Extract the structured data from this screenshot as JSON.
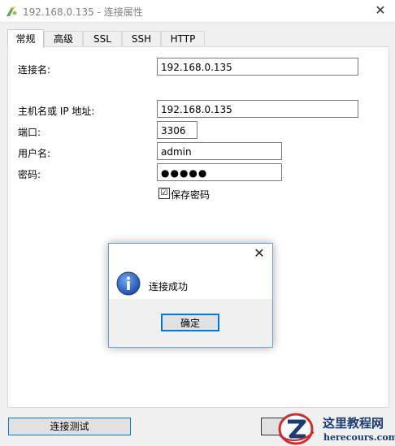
{
  "window": {
    "title": "192.168.0.135 - 连接属性",
    "close_glyph": "✕"
  },
  "tabs": [
    {
      "label": "常规",
      "active": true
    },
    {
      "label": "高级"
    },
    {
      "label": "SSL"
    },
    {
      "label": "SSH"
    },
    {
      "label": "HTTP"
    }
  ],
  "form": {
    "connection_name_label": "连接名:",
    "connection_name_value": "192.168.0.135",
    "host_label": "主机名或 IP 地址:",
    "host_value": "192.168.0.135",
    "port_label": "端口:",
    "port_value": "3306",
    "user_label": "用户名:",
    "user_value": "admin",
    "password_label": "密码:",
    "password_value": "●●●●●",
    "save_password_label": "保存密码",
    "save_password_checked": "☑"
  },
  "buttons": {
    "test_connection": "连接测试"
  },
  "dialog": {
    "close_glyph": "✕",
    "message": "连接成功",
    "ok": "确定"
  },
  "watermark": {
    "title": "这里教程网",
    "url": "herecours.com"
  },
  "colors": {
    "accent": "#0078d7",
    "info_icon": "#1f5fbf"
  }
}
